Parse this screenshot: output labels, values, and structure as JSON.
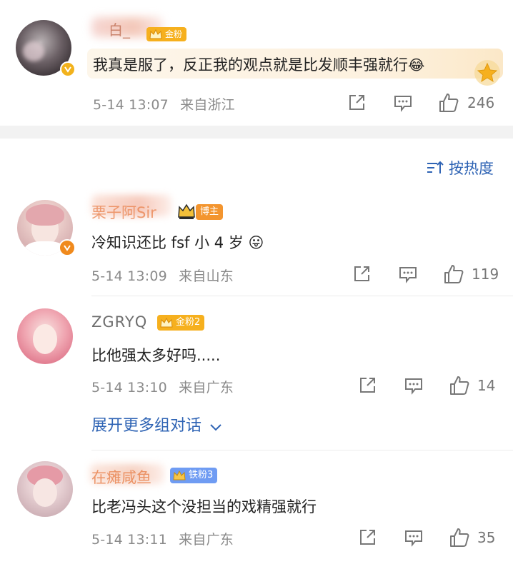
{
  "colors": {
    "accent_link": "#2e63b4",
    "name_orange": "#e9804a",
    "badge_gold": "#f6b01e",
    "badge_blue": "#6f9cf3",
    "badge_orange": "#f3952f"
  },
  "top_comment": {
    "user_name": "白_",
    "badge_label": "金粉",
    "text": "我真是服了，反正我的观点就是比发顺丰强就行",
    "emoji": "😂",
    "time": "5-14 13:07",
    "location": "来自浙江",
    "likes": "246"
  },
  "sort": {
    "icon": "sort-icon",
    "label": "按热度"
  },
  "comments": [
    {
      "user_name": "栗子阿Sir",
      "badge_label": "博主",
      "text": "冷知识还比 fsf 小 4 岁",
      "emoji": "😛",
      "time": "5-14 13:09",
      "location": "来自山东",
      "likes": "119"
    },
    {
      "user_name": "ZGRYQ",
      "badge_label": "金粉2",
      "text": "比他强太多好吗.....",
      "time": "5-14 13:10",
      "location": "来自广东",
      "likes": "14",
      "expand_label": "展开更多组对话"
    },
    {
      "user_name": "在瘫咸鱼",
      "badge_label": "铁粉3",
      "text": "比老冯头这个没担当的戏精强就行",
      "time": "5-14 13:11",
      "location": "来自广东",
      "likes": "35"
    }
  ]
}
